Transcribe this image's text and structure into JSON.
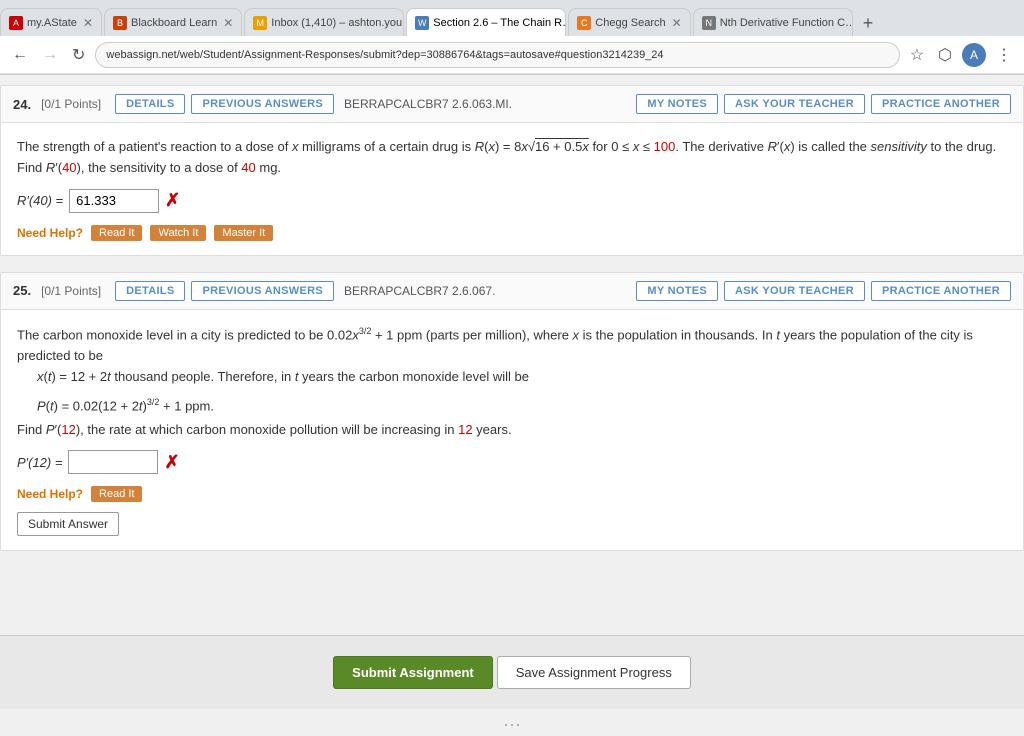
{
  "browser": {
    "tabs": [
      {
        "id": "tab1",
        "label": "my.AState",
        "active": false,
        "favicon": "🏠"
      },
      {
        "id": "tab2",
        "label": "Blackboard Learn",
        "active": false,
        "favicon": "📋"
      },
      {
        "id": "tab3",
        "label": "Inbox (1,410) – ashton.you…",
        "active": false,
        "favicon": "✉"
      },
      {
        "id": "tab4",
        "label": "Section 2.6 – The Chain R…",
        "active": true,
        "favicon": "📘"
      },
      {
        "id": "tab5",
        "label": "Chegg Search",
        "active": false,
        "favicon": "🟠"
      },
      {
        "id": "tab6",
        "label": "Nth Derivative Function C…",
        "active": false,
        "favicon": "📑"
      }
    ],
    "address": "webassign.net/web/Student/Assignment-Responses/submit?dep=30886764&tags=autosave#question3214239_24",
    "nav_back_disabled": false,
    "nav_forward_disabled": true
  },
  "questions": [
    {
      "number": "24.",
      "points": "[0/1 Points]",
      "details_label": "DETAILS",
      "prev_answers_label": "PREVIOUS ANSWERS",
      "problem_id": "BERRAPCALCBR7 2.6.063.MI.",
      "my_notes_label": "MY NOTES",
      "ask_teacher_label": "ASK YOUR TEACHER",
      "practice_another_label": "PRACTICE ANOTHER",
      "body_text": "The strength of a patient's reaction to a dose of x milligrams of a certain drug is R(x) = 8x√16 + 0.5x for 0 ≤ x ≤ 100. The derivative R′(x) is called the sensitivity to the drug. Find R′(40), the sensitivity to a dose of 40 mg.",
      "answer_label": "R′(40) =",
      "answer_value": "61.333",
      "need_help_label": "Need Help?",
      "help_buttons": [
        "Read It",
        "Watch It",
        "Master It"
      ]
    },
    {
      "number": "25.",
      "points": "[0/1 Points]",
      "details_label": "DETAILS",
      "prev_answers_label": "PREVIOUS ANSWERS",
      "problem_id": "BERRAPCALCBR7 2.6.067.",
      "my_notes_label": "MY NOTES",
      "ask_teacher_label": "ASK YOUR TEACHER",
      "practice_another_label": "PRACTICE ANOTHER",
      "body_text1": "The carbon monoxide level in a city is predicted to be 0.02x",
      "body_text2": "3/2",
      "body_text3": " + 1 ppm (parts per million), where x is the population in thousands. In t years the population of the city is predicted to be",
      "body_line2": "x(t) = 12 + 2t thousand people. Therefore, in t years the carbon monoxide level will be",
      "formula": "P(t) = 0.02(12 + 2t)",
      "formula_exp": "3/2",
      "formula_end": " + 1 ppm.",
      "find_text1": "Find P′(12), the rate at which carbon monoxide pollution will be increasing in ",
      "find_highlight": "12",
      "find_text2": " years.",
      "answer_label": "P′(12) =",
      "answer_value": "",
      "need_help_label": "Need Help?",
      "help_buttons": [
        "Read It"
      ],
      "submit_answer_label": "Submit Answer"
    }
  ],
  "footer": {
    "submit_assignment_label": "Submit Assignment",
    "save_progress_label": "Save Assignment Progress"
  }
}
